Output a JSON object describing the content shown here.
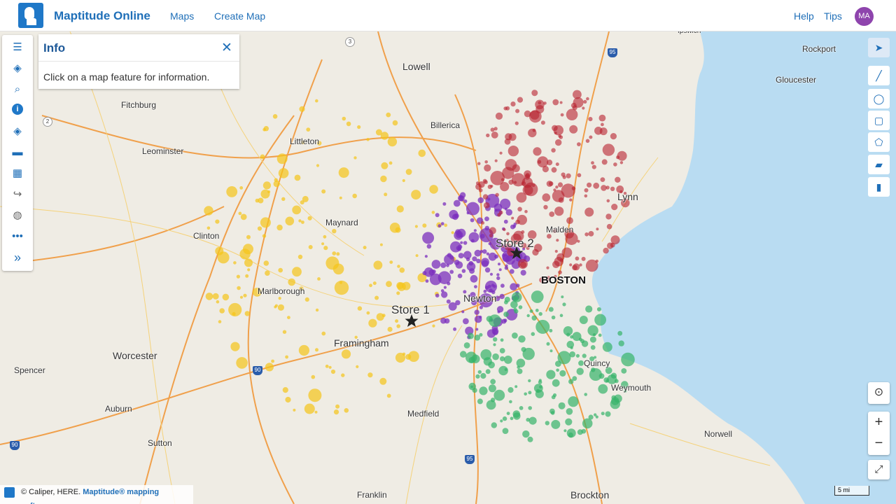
{
  "app": {
    "title": "Maptitude Online",
    "nav": [
      "Maps",
      "Create Map"
    ],
    "right_links": [
      "Help",
      "Tips"
    ],
    "avatar": "MA"
  },
  "info_panel": {
    "title": "Info",
    "message": "Click on a map feature for information."
  },
  "left_toolbar": [
    "list-icon",
    "layers-icon",
    "search-icon",
    "info-icon",
    "layers-alt-icon",
    "car-icon",
    "grid-icon",
    "share-icon",
    "globe-icon",
    "more-icon",
    "expand-icon"
  ],
  "right_toolbar": [
    "pointer-icon",
    "line-draw-icon",
    "circle-select-icon",
    "rectangle-select-icon",
    "polygon-select-icon",
    "ruler-icon",
    "trash-icon"
  ],
  "map": {
    "places": [
      "Lowell",
      "Rockport",
      "Gloucester",
      "Fitchburg",
      "Billerica",
      "Leominster",
      "Littleton",
      "Lynn",
      "Maynard",
      "Clinton",
      "Malden",
      "Marlborough",
      "Newton",
      "Framingham",
      "Worcester",
      "Quincy",
      "Weymouth",
      "Spencer",
      "Medfield",
      "Auburn",
      "Sutton",
      "Norwell",
      "Franklin",
      "Brockton",
      "Ipswich"
    ],
    "city": "BOSTON",
    "stores": [
      "Store 1",
      "Store 2"
    ],
    "route_shields": [
      "95",
      "3",
      "2",
      "90",
      "90",
      "95",
      "90"
    ],
    "cluster_colors": {
      "yellow": "#f5c518",
      "purple": "#7b2fbe",
      "red": "#b8222e",
      "green": "#36b36a"
    },
    "water_color": "#b9dcf2",
    "land_color": "#efece4"
  },
  "attribution": {
    "text": "© Caliper, HERE.",
    "link": "Maptitude® mapping software."
  },
  "scale_label": "5 mi"
}
